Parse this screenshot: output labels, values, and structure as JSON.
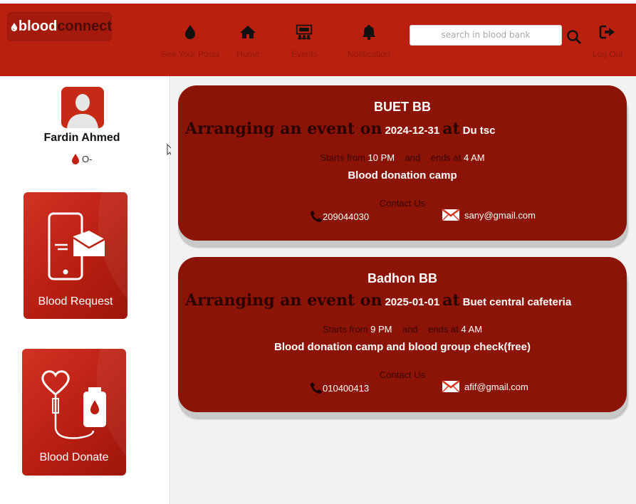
{
  "brand": {
    "part1": "blood",
    "part2": "connect"
  },
  "nav": {
    "posts_label": "See Your Posts",
    "home_label": "Home",
    "events_label": "Events",
    "notification_label": "Notification",
    "logout_label": "Log Out"
  },
  "search": {
    "placeholder": "search in blood bank"
  },
  "user": {
    "name": "Fardin Ahmed",
    "blood_group": "O-"
  },
  "actions": {
    "request_label": "Blood Request",
    "donate_label": "Blood Donate"
  },
  "events": [
    {
      "org": "BUET BB",
      "arranging_prefix": "Arranging an event on",
      "date": "2024-12-31",
      "at_label": "at",
      "location": "Du tsc",
      "starts_label": "Starts from",
      "start_time": "10 PM",
      "and_label": "and",
      "ends_label": "ends at",
      "end_time": "4 AM",
      "description": "Blood donation camp",
      "contact_label": "Contact Us",
      "phone": "209044030",
      "email": "sany@gmail.com"
    },
    {
      "org": "Badhon BB",
      "arranging_prefix": "Arranging an event on",
      "date": "2025-01-01",
      "at_label": "at",
      "location": "Buet central cafeteria",
      "starts_label": "Starts from",
      "start_time": "9 PM",
      "and_label": "and",
      "ends_label": "ends at",
      "end_time": "4 AM",
      "description": "Blood donation camp and blood group check(free)",
      "contact_label": "Contact Us",
      "phone": "010400413",
      "email": "afif@gmail.com"
    }
  ],
  "colors": {
    "header": "#b9200f",
    "event_card": "#8b1407",
    "accent_dark": "#2a0402"
  }
}
